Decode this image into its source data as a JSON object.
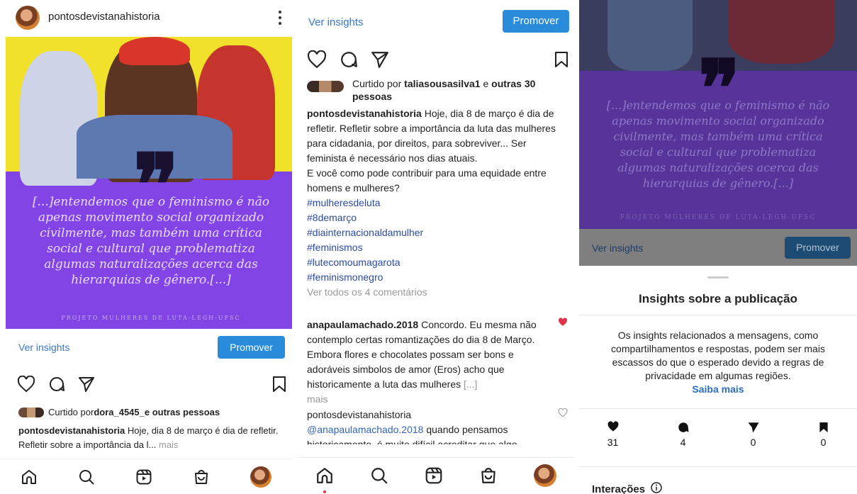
{
  "panel1": {
    "username": "pontosdevistanahistoria",
    "quote": "[...]entendemos que o feminismo é não apenas movimento social organizado civilmente, mas também uma crítica social e cultural que problematiza algumas naturalizações acerca das hierarquias de gênero.[...]",
    "credit": "PROJETO MULHERES DE LUTA-LEGH-UFSC",
    "ver_insights": "Ver insights",
    "promover": "Promover",
    "liked_by_prefix": "Curtido por ",
    "liked_by_user": "dora_4545_",
    "liked_by_suffix": " e outras pessoas",
    "caption_user": "pontosdevistanahistoria",
    "caption_text": " Hoje, dia 8 de março é  dia de refletir. Refletir sobre a importância da l...",
    "more": " mais"
  },
  "panel2": {
    "ver_insights": "Ver insights",
    "promover": "Promover",
    "liked_by_prefix": "Curtido por ",
    "liked_by_user": "taliasousasilva1",
    "liked_by_mid": " e ",
    "liked_by_others": "outras 30 pessoas",
    "caption_user": "pontosdevistanahistoria",
    "caption_line1": " Hoje, dia 8 de março é  dia de refletir. Refletir sobre a importância da luta das mulheres para cidadania, por direitos, para sobreviver... Ser feminista é  necessário nos dias atuais.",
    "caption_line2": "E você  como pode contribuir para uma equidade entre homens e mulheres?",
    "hashtags": [
      "#mulheresdeluta",
      "#8demarço",
      "#diainternacionaldamulher",
      "#feminismos",
      "#lutecomoumagarota",
      "#feminismonegro"
    ],
    "view_comments": "Ver todos os 4 comentários",
    "comment1_user": "anapaulamachado.2018",
    "comment1_text": " Concordo. Eu mesma não contemplo certas romantizações do dia 8 de Março. Embora flores e chocolates possam ser bons e adoráveis simbolos de amor (Eros) acho que historicamente a luta das mulheres ",
    "comment1_ellipsis": "[...]",
    "comment1_more": "mais",
    "comment2_user": "pontosdevistanahistoria",
    "comment2_mention": "@anapaulamachado.2018",
    "comment2_text": " quando pensamos historicamente, é muito difícil acreditar que algo"
  },
  "panel3": {
    "quote": "[...]entendemos que o feminismo é não apenas movimento social organizado civilmente, mas também uma crítica social e cultural que problematiza algumas naturalizações acerca das hierarquias de gênero.[...]",
    "credit": "PROJETO MULHERES DE LUTA-LEGH-UFSC",
    "ver_insights": "Ver insights",
    "promover": "Promover",
    "sheet_title": "Insights sobre a publicação",
    "notice": "Os insights relacionados a mensagens, como compartilhamentos e respostas, podem ser mais escassos do que o esperado devido a regras de privacidade em algumas regiões.",
    "learn_more": "Saiba mais",
    "stats": [
      {
        "icon": "heart-icon",
        "value": "31"
      },
      {
        "icon": "comment-icon",
        "value": "4"
      },
      {
        "icon": "share-icon",
        "value": "0"
      },
      {
        "icon": "bookmark-icon",
        "value": "0"
      }
    ],
    "interactions_label": "Interações"
  },
  "colors": {
    "accent": "#2b8bdb",
    "purple": "#8344e6",
    "yellow": "#f1e12a",
    "link": "#3a77c8",
    "heart_red": "#e0344a"
  }
}
